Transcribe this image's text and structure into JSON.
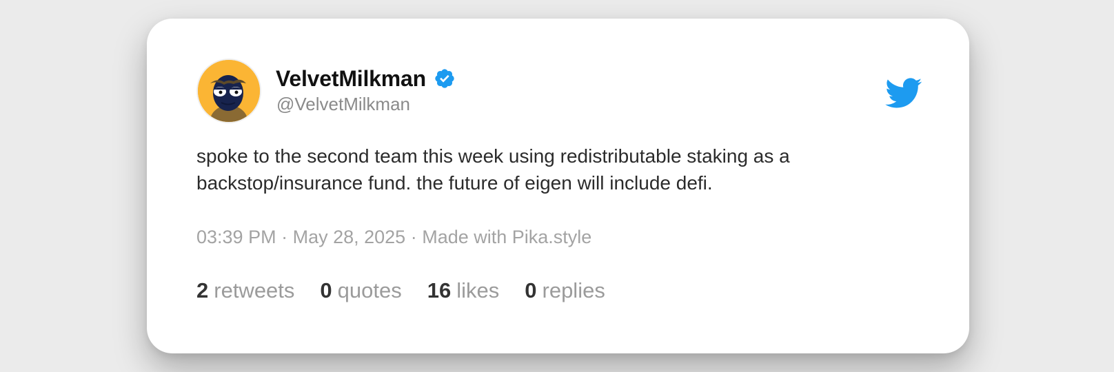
{
  "tweet": {
    "display_name": "VelvetMilkman",
    "handle": "@VelvetMilkman",
    "text": "spoke to the second team this week using redistributable staking as a backstop/insurance fund. the future of eigen will include defi.",
    "time": "03:39 PM",
    "date": "May 28, 2025",
    "credit": "Made with Pika.style",
    "separator": "·"
  },
  "stats": [
    {
      "value": "2",
      "label": "retweets"
    },
    {
      "value": "0",
      "label": "quotes"
    },
    {
      "value": "16",
      "label": "likes"
    },
    {
      "value": "0",
      "label": "replies"
    }
  ],
  "icons": {
    "avatar": "avatar-illustration",
    "verified": "verified-badge-icon",
    "brand": "twitter-bird-icon"
  },
  "colors": {
    "background": "#ebebeb",
    "card": "#ffffff",
    "twitter_blue": "#1d9bf0",
    "avatar_bg": "#fbb534",
    "name": "#111111",
    "muted": "#9b9b9b"
  }
}
